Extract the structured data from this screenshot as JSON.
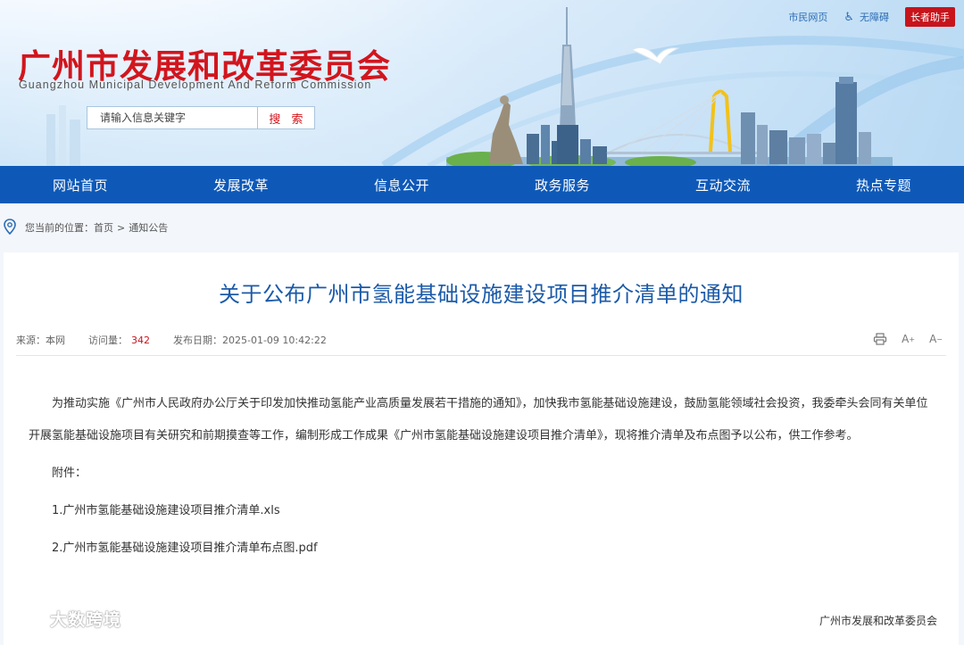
{
  "header": {
    "site_title": "广州市发展和改革委员会",
    "site_subtitle": "Guangzhou Municipal Development And Reform Commission",
    "search_placeholder": "请输入信息关键字",
    "search_button": "搜 索",
    "top_links": {
      "citizen": "市民网页",
      "accessibility": "无障碍",
      "elder_assistant": "长者助手"
    }
  },
  "nav": {
    "items": [
      {
        "label": "网站首页"
      },
      {
        "label": "发展改革"
      },
      {
        "label": "信息公开"
      },
      {
        "label": "政务服务"
      },
      {
        "label": "互动交流"
      },
      {
        "label": "热点专题"
      }
    ]
  },
  "breadcrumb": {
    "prefix": "您当前的位置：",
    "home": "首页",
    "separator": ">",
    "current": "通知公告"
  },
  "article": {
    "title": "关于公布广州市氢能基础设施建设项目推介清单的通知",
    "meta": {
      "source_label": "来源：",
      "source_value": "本网",
      "visits_label": "访问量：",
      "visits_value": "342",
      "date_label": "发布日期：",
      "date_value": "2025-01-09 10:42:22"
    },
    "tools": {
      "print_icon": "printer-icon",
      "font_increase": "A",
      "font_decrease": "A"
    },
    "paragraph": "为推动实施《广州市人民政府办公厅关于印发加快推动氢能产业高质量发展若干措施的通知》，加快我市氢能基础设施建设，鼓励氢能领域社会投资，我委牵头会同有关单位开展氢能基础设施项目有关研究和前期摸查等工作，编制形成工作成果《广州市氢能基础设施建设项目推介清单》，现将推介清单及布点图予以公布，供工作参考。",
    "attachments_label": "附件：",
    "attachments": [
      "1.广州市氢能基础设施建设项目推介清单.xls",
      "2.广州市氢能基础设施建设项目推介清单布点图.pdf"
    ],
    "signature": "广州市发展和改革委员会"
  },
  "watermark": {
    "text": "大数跨境"
  },
  "colors": {
    "brand_red": "#d2151d",
    "nav_blue": "#0e59b8",
    "title_blue": "#1b5aa8",
    "visits_red": "#c7141b"
  }
}
